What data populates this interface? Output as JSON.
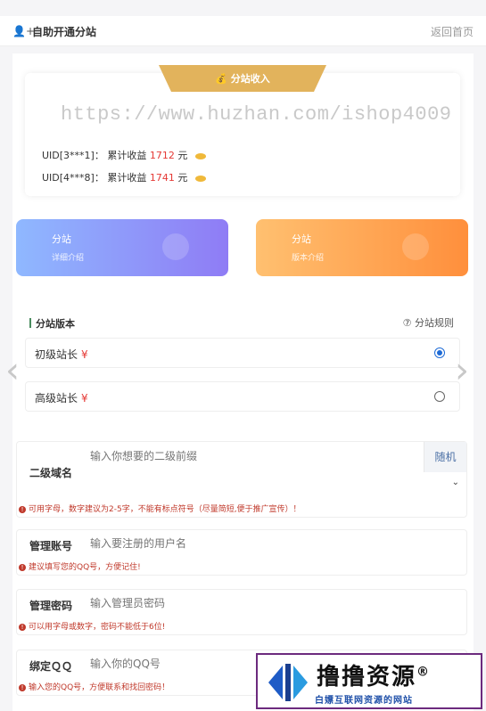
{
  "header": {
    "icon": "user-plus-icon",
    "title": "自助开通分站",
    "back": "返回首页"
  },
  "income": {
    "ribbon": "分站收入",
    "ribbon_icon": "money-bag-icon",
    "watermark": "https://www.huzhan.com/ishop4009",
    "rows": [
      {
        "uid": "UID[3***1]：",
        "label": "累计收益",
        "amount": "1712",
        "unit": "元"
      },
      {
        "uid": "UID[4***8]：",
        "label": "累计收益",
        "amount": "1741",
        "unit": "元"
      }
    ]
  },
  "cards": [
    {
      "title": "分站",
      "subtitle": "详细介绍"
    },
    {
      "title": "分站",
      "subtitle": "版本介绍"
    }
  ],
  "version": {
    "title": "分站版本",
    "rules": "⑦ 分站规则",
    "options": [
      {
        "label": "初级站长",
        "price": "¥",
        "selected": true
      },
      {
        "label": "高级站长",
        "price": "¥",
        "selected": false
      }
    ]
  },
  "form": {
    "domain": {
      "label": "二级域名",
      "placeholder": "输入你想要的二级前缀",
      "button": "随机",
      "hint": "可用字母，数字建议为2-5字，不能有标点符号（尽量简短,便于推广宣传）！"
    },
    "account": {
      "label": "管理账号",
      "placeholder": "输入要注册的用户名",
      "hint": "建议填写您的QQ号，方便记住!"
    },
    "password": {
      "label": "管理密码",
      "placeholder": "输入管理员密码",
      "hint": "可以用字母或数字，密码不能低于6位!"
    },
    "qq": {
      "label": "绑定ＱＱ",
      "placeholder": "输入你的QQ号",
      "hint": "输入您的QQ号，方便联系和找回密码！"
    }
  },
  "logo": {
    "main": "撸撸资源",
    "registered": "®",
    "sub": "白嫖互联网资源的网站"
  },
  "colors": {
    "accent_blue": "#1e6bd6",
    "hint_red": "#c0392b",
    "ribbon_gold": "#e2b35c"
  }
}
